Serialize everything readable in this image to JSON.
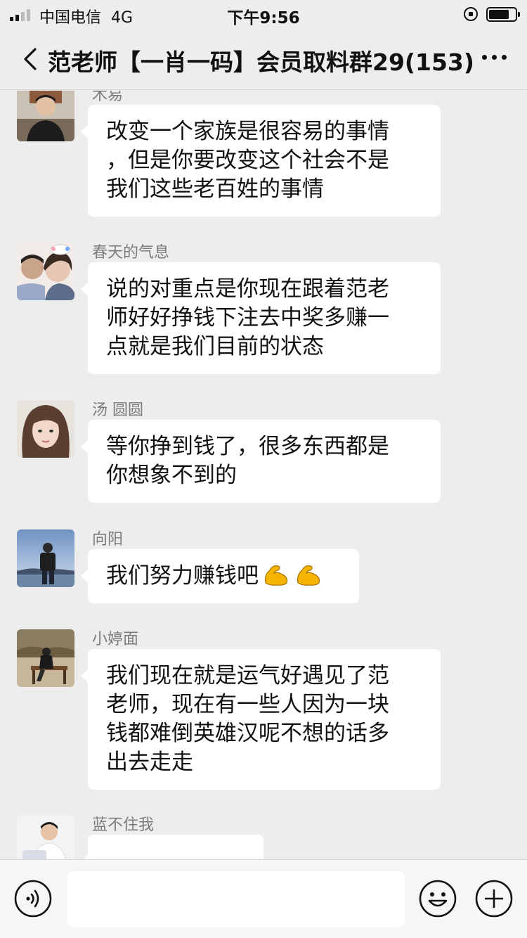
{
  "status_bar": {
    "carrier": "中国电信",
    "network": "4G",
    "time": "下午9:56"
  },
  "nav": {
    "title": "范老师【一肖一码】会员取料群29(153)"
  },
  "messages": [
    {
      "sender": "木易",
      "lines": [
        "改变一个家族是很容易的事情",
        "，但是你要改变这个社会不是",
        "我们这些老百姓的事情"
      ]
    },
    {
      "sender": "春天的气息",
      "lines": [
        "说的对重点是你现在跟着范老",
        "师好好挣钱下注去中奖多赚一",
        "点就是我们目前的状态"
      ]
    },
    {
      "sender": "汤 圆圆",
      "lines": [
        "等你挣到钱了，很多东西都是",
        "你想象不到的"
      ]
    },
    {
      "sender": "向阳",
      "lines": [
        "我们努力赚钱吧"
      ],
      "emoji": [
        "flexed-biceps",
        "flexed-biceps"
      ]
    },
    {
      "sender": "小婷面",
      "lines": [
        "我们现在就是运气好遇见了范",
        "老师，现在有一些人因为一块",
        "钱都难倒英雄汉呢不想的话多",
        "出去走走"
      ]
    },
    {
      "sender": "蓝不住我"
    }
  ],
  "input_bar": {
    "placeholder": "",
    "icons": [
      "voice-icon",
      "emoji-icon",
      "plus-icon"
    ]
  },
  "colors": {
    "background": "#ededed",
    "bubble": "#ffffff",
    "sender": "#7b7b7b",
    "emoji": "#f4b400"
  }
}
